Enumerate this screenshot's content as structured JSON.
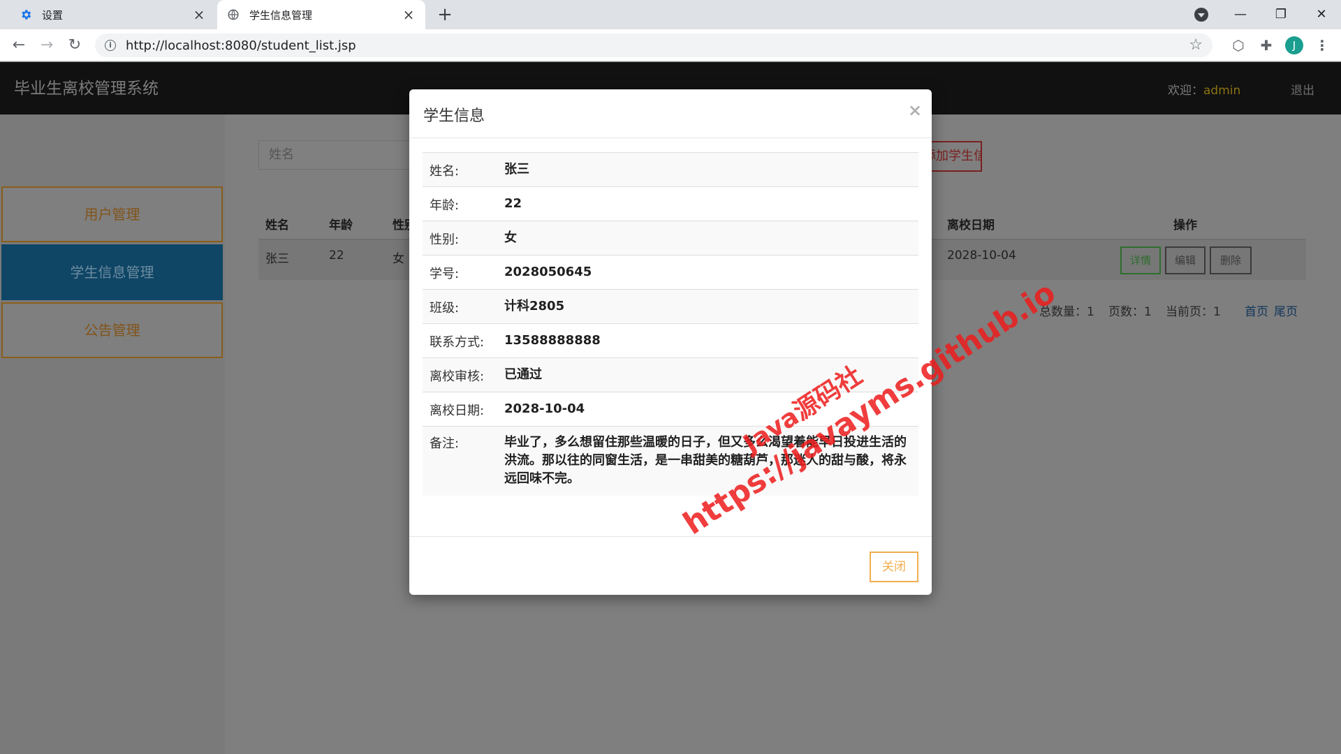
{
  "browser": {
    "tabs": [
      {
        "title": "设置",
        "icon": "gear-icon"
      },
      {
        "title": "学生信息管理",
        "icon": "globe-icon"
      }
    ],
    "tab_close": "×",
    "new_tab": "+",
    "url": "http://localhost:8080/student_list.jsp",
    "nav": {
      "back": "←",
      "forward": "→",
      "reload": "↻"
    },
    "window": {
      "minimize": "—",
      "restore": "❐",
      "close": "✕"
    },
    "star": "☆",
    "profile_initial": "J"
  },
  "app": {
    "brand": "毕业生离校管理系统",
    "welcome_prefix": "欢迎：",
    "username": "admin",
    "logout": "退出"
  },
  "sidebar": {
    "items": [
      {
        "label": "用户管理"
      },
      {
        "label": "学生信息管理"
      },
      {
        "label": "公告管理"
      }
    ]
  },
  "toolbar": {
    "search_placeholder": "姓名",
    "add_button": "添加学生信息"
  },
  "table": {
    "headers": {
      "name": "姓名",
      "age": "年龄",
      "gender": "性别",
      "leave_date": "离校日期",
      "actions": "操作"
    },
    "row": {
      "name": "张三",
      "age": "22",
      "gender": "女",
      "leave_date": "2028-10-04"
    },
    "buttons": {
      "detail": "详情",
      "edit": "编辑",
      "delete": "删除"
    }
  },
  "pagination": {
    "total_label": "总数量：",
    "total": "1",
    "pages_label": "页数：",
    "pages": "1",
    "current_label": "当前页：",
    "current": "1",
    "first": "首页",
    "last": "尾页"
  },
  "modal": {
    "title": "学生信息",
    "close_x": "×",
    "fields": [
      {
        "label": "姓名:",
        "value": "张三"
      },
      {
        "label": "年龄:",
        "value": "22"
      },
      {
        "label": "性别:",
        "value": "女"
      },
      {
        "label": "学号:",
        "value": "2028050645"
      },
      {
        "label": "班级:",
        "value": "计科2805"
      },
      {
        "label": "联系方式:",
        "value": "13588888888"
      },
      {
        "label": "离校审核:",
        "value": "已通过"
      },
      {
        "label": "离校日期:",
        "value": "2028-10-04"
      },
      {
        "label": "备注:",
        "value": "毕业了，多么想留住那些温暖的日子，但又多么渴望着能早日投进生活的洪流。那以往的同窗生活，是一串甜美的糖葫芦，那迷人的甜与酸，将永远回味不完。"
      }
    ],
    "close_button": "关闭"
  },
  "watermark": {
    "line1": "Java源码社",
    "line2": "https://javayms.github.io"
  },
  "colors": {
    "accent_orange": "#f0ad4e",
    "sidebar_active": "#0f4565",
    "watermark_red": "#ee1c1c"
  }
}
